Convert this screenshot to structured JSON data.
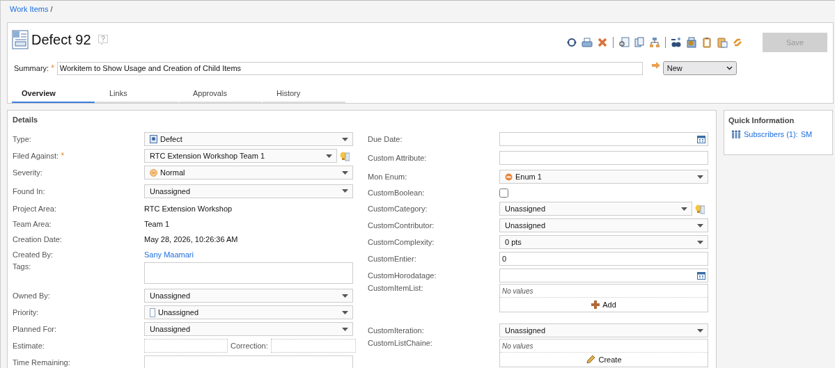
{
  "breadcrumb": {
    "link": "Work Items",
    "separator": "/"
  },
  "title": "Defect 92",
  "save_button": {
    "label": "Save",
    "disabled": true
  },
  "summary": {
    "label": "Summary:",
    "required_mark": "*",
    "value": "Workitem to Show Usage and Creation of Child Items"
  },
  "state": {
    "value": "New"
  },
  "tabs": [
    {
      "label": "Overview",
      "selected": true
    },
    {
      "label": "Links",
      "selected": false
    },
    {
      "label": "Approvals",
      "selected": false
    },
    {
      "label": "History",
      "selected": false
    }
  ],
  "details": {
    "title": "Details",
    "left": [
      {
        "kind": "select",
        "label": "Type:",
        "value": "Defect"
      },
      {
        "kind": "select_helper",
        "label": "Filed Against:",
        "required_mark": "*",
        "value": "RTC Extension Workshop Team 1"
      },
      {
        "kind": "select",
        "label": "Severity:",
        "value": "Normal"
      },
      {
        "kind": "select",
        "label": "Found In:",
        "value": "Unassigned"
      },
      {
        "kind": "text",
        "label": "Project Area:",
        "value": "RTC Extension Workshop"
      },
      {
        "kind": "text",
        "label": "Team Area:",
        "value": "Team 1"
      },
      {
        "kind": "text",
        "label": "Creation Date:",
        "value": "May 28, 2026, 10:26:36 AM"
      },
      {
        "kind": "link",
        "label": "Created By:",
        "value": "Sany Maamari"
      },
      {
        "kind": "textarea",
        "label": "Tags:"
      },
      {
        "kind": "select",
        "label": "Owned By:",
        "value": "Unassigned"
      },
      {
        "kind": "select",
        "label": "Priority:",
        "value": "Unassigned"
      },
      {
        "kind": "select",
        "label": "Planned For:",
        "value": "Unassigned"
      },
      {
        "kind": "estimate",
        "label": "Estimate:",
        "second_label": "Correction:"
      },
      {
        "kind": "input",
        "label": "Time Remaining:"
      }
    ],
    "right": [
      {
        "kind": "date",
        "label": "Due Date:"
      },
      {
        "kind": "input",
        "label": "Custom Attribute:"
      },
      {
        "kind": "select",
        "label": "Mon Enum:",
        "value": "Enum 1"
      },
      {
        "kind": "checkbox",
        "label": "CustomBoolean:",
        "checked": false
      },
      {
        "kind": "select_helper",
        "label": "CustomCategory:",
        "value": "Unassigned"
      },
      {
        "kind": "select",
        "label": "CustomContributor:",
        "value": "Unassigned"
      },
      {
        "kind": "select",
        "label": "CustomComplexity:",
        "value": "0 pts"
      },
      {
        "kind": "input",
        "label": "CustomEntier:",
        "value": "0"
      },
      {
        "kind": "date",
        "label": "CustomHorodatage:"
      },
      {
        "kind": "add_list",
        "label": "CustomItemList:",
        "empty": "No values",
        "action": "Add"
      },
      {
        "kind": "select",
        "label": "CustomIteration:",
        "value": "Unassigned"
      },
      {
        "kind": "create_list",
        "label": "CustomListChaine:",
        "empty": "No values",
        "action": "Create"
      }
    ]
  },
  "quick_information": {
    "title": "Quick Information",
    "subscribers": "Subscribers (1):",
    "initials": "SM"
  }
}
